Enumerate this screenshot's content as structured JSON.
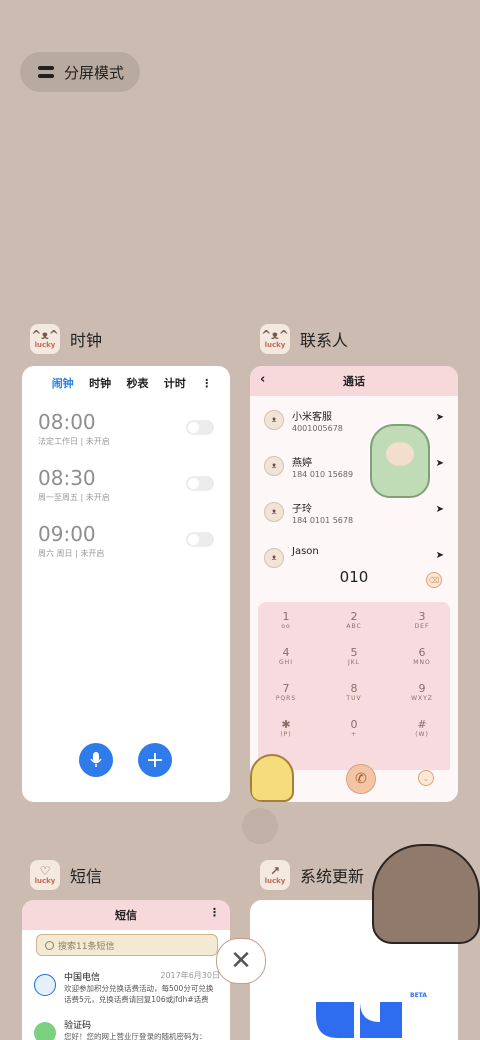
{
  "split_mode": {
    "label": "分屏模式"
  },
  "apps": {
    "clock": {
      "title": "时钟",
      "icon_text": "lucky",
      "tabs": [
        "闹钟",
        "时钟",
        "秒表",
        "计时"
      ],
      "active_tab": 0,
      "alarms": [
        {
          "time": "08:00",
          "sub": "法定工作日 | 未开启",
          "enabled": false
        },
        {
          "time": "08:30",
          "sub": "周一至周五 | 未开启",
          "enabled": false
        },
        {
          "time": "09:00",
          "sub": "周六 周日 | 未开启",
          "enabled": false
        }
      ],
      "mic_icon": "mic-icon",
      "add_icon": "plus-icon"
    },
    "contacts": {
      "title": "联系人",
      "icon_text": "lucky",
      "bar_title": "通话",
      "contacts": [
        {
          "name": "小米客服",
          "num": "4001005678"
        },
        {
          "name": "燕婷",
          "num": "184 010 15689"
        },
        {
          "name": "子玲",
          "num": "184 0101 5678"
        },
        {
          "name": "Jason",
          "num": ""
        }
      ],
      "dialed": "010",
      "keys": [
        {
          "d": "1",
          "l": "oo"
        },
        {
          "d": "2",
          "l": "ABC"
        },
        {
          "d": "3",
          "l": "DEF"
        },
        {
          "d": "4",
          "l": "GHI"
        },
        {
          "d": "5",
          "l": "JKL"
        },
        {
          "d": "6",
          "l": "MNO"
        },
        {
          "d": "7",
          "l": "PQRS"
        },
        {
          "d": "8",
          "l": "TUV"
        },
        {
          "d": "9",
          "l": "WXYZ"
        },
        {
          "d": "✱",
          "l": "(P)"
        },
        {
          "d": "0",
          "l": "+"
        },
        {
          "d": "#",
          "l": "(W)"
        }
      ]
    },
    "sms": {
      "title": "短信",
      "icon_text": "lucky",
      "bar_title": "短信",
      "search_placeholder": "搜索11条短信",
      "messages": [
        {
          "name": "中国电信",
          "date": "2017年6月30日",
          "text": "欢迎参加积分兑换话费活动，每500分可兑换话费5元，兑换话费请回复106或jfdh#话费"
        },
        {
          "name": "验证码",
          "date": "",
          "text": "您好！您的网上营业厅登录的随机密码为："
        }
      ]
    },
    "update": {
      "title": "系统更新",
      "icon_text": "lucky",
      "beta": "BETA"
    }
  },
  "colors": {
    "background": "#cbbbb0",
    "accent": "#2f7bea",
    "pink_bar": "#f7d9dc"
  }
}
